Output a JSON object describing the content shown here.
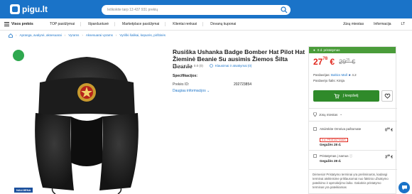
{
  "header": {
    "logo": "pigu.lt",
    "search_placeholder": "Ieškokite tarp 13 437 931 prekių"
  },
  "nav": {
    "categories": "Visos prekės",
    "links": [
      "TOP pasiūlymai",
      "Išparduotuvė",
      "Marketplace pasiūlymai",
      "Klientai renkasi",
      "Dovanų kuponai"
    ],
    "city": "Jūsų miestas",
    "info": "Informacija",
    "lang": "LT"
  },
  "breadcrumbs": [
    "Apranga, avalynė, aksesuarai",
    "Vyrams",
    "Aksesuarai vyrams",
    "Vyriški šalikai, kepurės, pirštinės"
  ],
  "product": {
    "badge_new": "NAUJIENA",
    "title": "Rusiška Ushanka Badge Bomber Hat Pilot Hat Žieminė Beanie Su ausimis Žiemos Šilta Beanie",
    "rating_text": "0.0  (0)",
    "questions_link": "Klausimai ir atsakymai (0)",
    "specs_heading": "Specifikacijos:",
    "spec_label": "Prekės ID:",
    "spec_value": "202723854",
    "more_link": "Daugiau informacijos"
  },
  "buybox": {
    "stock": "0 d. pristatymas",
    "price_main": "27",
    "price_cents": "78",
    "currency": "€",
    "old_main": "29",
    "old_cents": "25",
    "old_currency": "€",
    "seller_label": "Pardavėjas:",
    "seller_name": "Baltics Mall",
    "seller_rating": "4.2",
    "ship_from": "Pardavėjo šalis: Kinija",
    "cart_label": "Į krepšelį",
    "city_label": "Jūsų miestas",
    "options": [
      {
        "name": "Atsiimkite Omniva paštomate",
        "price": "0",
        "price_cents": "00",
        "tag": "0 d. PRISTATYMAS",
        "when": "Gegužės 28 d."
      },
      {
        "name": "Pristatymas į namus",
        "price": "3",
        "price_cents": "49",
        "when": "Gegužės 28 d."
      }
    ],
    "note": "Dėmesio! Pristatymo terminai yra preliminarūs, kadangi terminai atskleisime priklausomai nuo faktinio užsakymo pateikimo ir apmokėjimo laiko. Galutinis pristatymo terminas yra pateikiamas"
  }
}
